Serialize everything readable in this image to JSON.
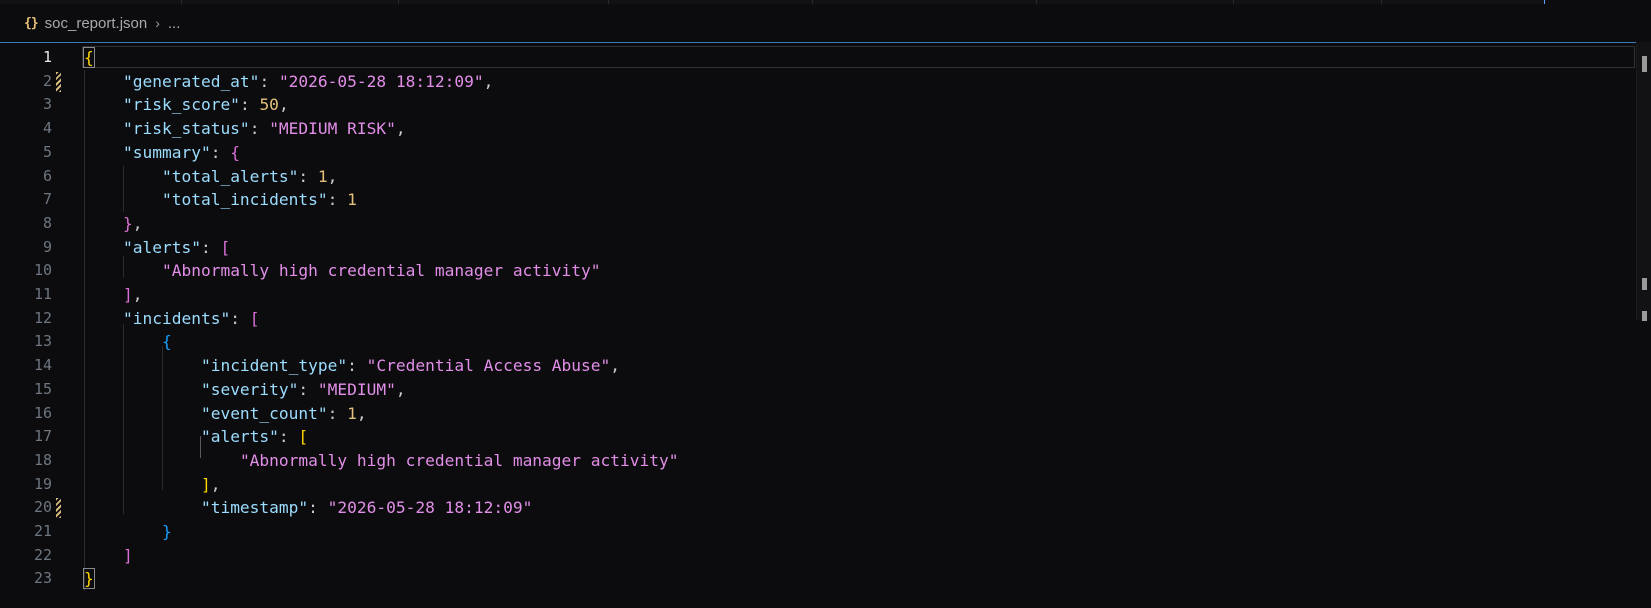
{
  "breadcrumb": {
    "file_icon": "{}",
    "file_name": "soc_report.json",
    "chevron": "›",
    "ellipsis": "..."
  },
  "editor": {
    "active_line": 1,
    "modified_lines": [
      2,
      20
    ],
    "lines": [
      {
        "n": "1",
        "t": [
          [
            "b1",
            "{"
          ]
        ]
      },
      {
        "n": "2",
        "t": [
          [
            "p",
            "    "
          ],
          [
            "k",
            "\"generated_at\""
          ],
          [
            "p",
            ": "
          ],
          [
            "s",
            "\"2026-05-28 18:12:09\""
          ],
          [
            "p",
            ","
          ]
        ]
      },
      {
        "n": "3",
        "t": [
          [
            "p",
            "    "
          ],
          [
            "k",
            "\"risk_score\""
          ],
          [
            "p",
            ": "
          ],
          [
            "n",
            "50"
          ],
          [
            "p",
            ","
          ]
        ]
      },
      {
        "n": "4",
        "t": [
          [
            "p",
            "    "
          ],
          [
            "k",
            "\"risk_status\""
          ],
          [
            "p",
            ": "
          ],
          [
            "s",
            "\"MEDIUM RISK\""
          ],
          [
            "p",
            ","
          ]
        ]
      },
      {
        "n": "5",
        "t": [
          [
            "p",
            "    "
          ],
          [
            "k",
            "\"summary\""
          ],
          [
            "p",
            ": "
          ],
          [
            "b2",
            "{"
          ]
        ]
      },
      {
        "n": "6",
        "t": [
          [
            "p",
            "        "
          ],
          [
            "k",
            "\"total_alerts\""
          ],
          [
            "p",
            ": "
          ],
          [
            "n",
            "1"
          ],
          [
            "p",
            ","
          ]
        ]
      },
      {
        "n": "7",
        "t": [
          [
            "p",
            "        "
          ],
          [
            "k",
            "\"total_incidents\""
          ],
          [
            "p",
            ": "
          ],
          [
            "n",
            "1"
          ]
        ]
      },
      {
        "n": "8",
        "t": [
          [
            "p",
            "    "
          ],
          [
            "b2",
            "}"
          ],
          [
            "p",
            ","
          ]
        ]
      },
      {
        "n": "9",
        "t": [
          [
            "p",
            "    "
          ],
          [
            "k",
            "\"alerts\""
          ],
          [
            "p",
            ": "
          ],
          [
            "b2",
            "["
          ]
        ]
      },
      {
        "n": "10",
        "t": [
          [
            "p",
            "        "
          ],
          [
            "s",
            "\"Abnormally high credential manager activity\""
          ]
        ]
      },
      {
        "n": "11",
        "t": [
          [
            "p",
            "    "
          ],
          [
            "b2",
            "]"
          ],
          [
            "p",
            ","
          ]
        ]
      },
      {
        "n": "12",
        "t": [
          [
            "p",
            "    "
          ],
          [
            "k",
            "\"incidents\""
          ],
          [
            "p",
            ": "
          ],
          [
            "b2",
            "["
          ]
        ]
      },
      {
        "n": "13",
        "t": [
          [
            "p",
            "        "
          ],
          [
            "b3",
            "{"
          ]
        ]
      },
      {
        "n": "14",
        "t": [
          [
            "p",
            "            "
          ],
          [
            "k",
            "\"incident_type\""
          ],
          [
            "p",
            ": "
          ],
          [
            "s",
            "\"Credential Access Abuse\""
          ],
          [
            "p",
            ","
          ]
        ]
      },
      {
        "n": "15",
        "t": [
          [
            "p",
            "            "
          ],
          [
            "k",
            "\"severity\""
          ],
          [
            "p",
            ": "
          ],
          [
            "s",
            "\"MEDIUM\""
          ],
          [
            "p",
            ","
          ]
        ]
      },
      {
        "n": "16",
        "t": [
          [
            "p",
            "            "
          ],
          [
            "k",
            "\"event_count\""
          ],
          [
            "p",
            ": "
          ],
          [
            "n",
            "1"
          ],
          [
            "p",
            ","
          ]
        ]
      },
      {
        "n": "17",
        "t": [
          [
            "p",
            "            "
          ],
          [
            "k",
            "\"alerts\""
          ],
          [
            "p",
            ": "
          ],
          [
            "b1",
            "["
          ]
        ]
      },
      {
        "n": "18",
        "t": [
          [
            "p",
            "                "
          ],
          [
            "s",
            "\"Abnormally high credential manager activity\""
          ]
        ]
      },
      {
        "n": "19",
        "t": [
          [
            "p",
            "            "
          ],
          [
            "b1",
            "]"
          ],
          [
            "p",
            ","
          ]
        ]
      },
      {
        "n": "20",
        "t": [
          [
            "p",
            "            "
          ],
          [
            "k",
            "\"timestamp\""
          ],
          [
            "p",
            ": "
          ],
          [
            "s",
            "\"2026-05-28 18:12:09\""
          ]
        ]
      },
      {
        "n": "21",
        "t": [
          [
            "p",
            "        "
          ],
          [
            "b3",
            "}"
          ]
        ]
      },
      {
        "n": "22",
        "t": [
          [
            "p",
            "    "
          ],
          [
            "b2",
            "]"
          ]
        ]
      },
      {
        "n": "23",
        "t": [
          [
            "b1",
            "}"
          ]
        ]
      }
    ]
  },
  "colors": {
    "key": "#9cdcfe",
    "string": "#e28ee8",
    "number": "#e5c07b",
    "bracket_level1": "#ffd700",
    "bracket_level2": "#da70d6",
    "bracket_level3": "#179fff",
    "accent": "#3b7bb8"
  }
}
